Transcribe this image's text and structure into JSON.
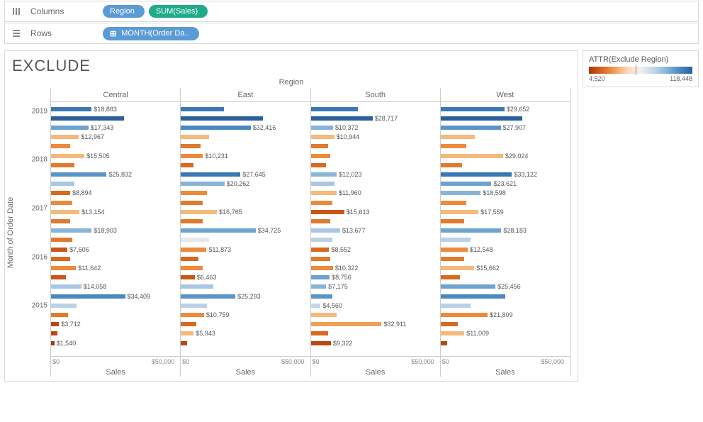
{
  "shelves": {
    "columns_label": "Columns",
    "rows_label": "Rows",
    "columns_pills": [
      {
        "label": "Region",
        "class": "blue"
      },
      {
        "label": "SUM(Sales)",
        "class": "green"
      }
    ],
    "rows_pills": [
      {
        "label": "MONTH(Order Da..",
        "class": "blue",
        "expand": true
      }
    ]
  },
  "title": "EXCLUDE",
  "region_header": "Region",
  "y_axis_title": "Month of Order Date",
  "x_axis_label": "Sales",
  "x_ticks": {
    "min": "$0",
    "max": "$50,000"
  },
  "y_year_ticks": [
    "2019",
    "2018",
    "2017",
    "2016",
    "2015"
  ],
  "legend": {
    "title": "ATTR(Exclude Region)",
    "min": "4,520",
    "max": "118,448",
    "marker_pct": 45
  },
  "chart_data": {
    "type": "bar",
    "title": "EXCLUDE",
    "xlabel": "Sales",
    "ylabel": "Month of Order Date",
    "xlim": [
      0,
      60000
    ],
    "color_field": "ATTR(Exclude Region)",
    "color_range": [
      4520,
      118448
    ],
    "panels": [
      "Central",
      "East",
      "South",
      "West"
    ],
    "labeled_values": {
      "Central": {
        "$18,883": 18883,
        "$17,343": 17343,
        "$12,967": 12967,
        "$15,505": 15505,
        "$25,832": 25832,
        "$8,894": 8894,
        "$13,154": 13154,
        "$18,903": 18903,
        "$7,606": 7606,
        "$11,642": 11642,
        "$14,058": 14058,
        "$34,409": 34409,
        "$3,712": 3712,
        "$1,540": 1540
      },
      "East": {
        "$32,416": 32416,
        "$10,231": 10231,
        "$27,645": 27645,
        "$20,262": 20262,
        "$16,765": 16765,
        "$34,725": 34725,
        "$11,873": 11873,
        "$6,463": 6463,
        "$25,293": 25293,
        "$10,759": 10759,
        "$5,943": 5943
      },
      "South": {
        "$28,717": 28717,
        "$10,372": 10372,
        "$10,944": 10944,
        "$12,023": 12023,
        "$11,960": 11960,
        "$15,613": 15613,
        "$13,677": 13677,
        "$8,552": 8552,
        "$10,322": 10322,
        "$8,756": 8756,
        "$7,175": 7175,
        "$4,560": 4560,
        "$32,911": 32911,
        "$9,322": 9322
      },
      "West": {
        "$29,652": 29652,
        "$27,907": 27907,
        "$29,024": 29024,
        "$33,122": 33122,
        "$23,621": 23621,
        "$18,598": 18598,
        "$17,559": 17559,
        "$28,183": 28183,
        "$12,548": 12548,
        "$15,662": 15662,
        "$25,456": 25456,
        "$21,809": 21809,
        "$11,009": 11009
      }
    }
  },
  "render_bars": {
    "Central": [
      {
        "t": 1,
        "v": 18883,
        "c": "#3a77b5",
        "l": "$18,883"
      },
      {
        "t": 2,
        "v": 34000,
        "c": "#2b5f9c"
      },
      {
        "t": 3,
        "v": 17343,
        "c": "#6fa3cf",
        "l": "$17,343"
      },
      {
        "t": 4,
        "v": 12967,
        "c": "#f4b97c",
        "l": "$12,967"
      },
      {
        "t": 5,
        "v": 9000,
        "c": "#ec8a3d"
      },
      {
        "t": 6,
        "v": 15505,
        "c": "#f4b97c",
        "l": "$15,505"
      },
      {
        "t": 7,
        "v": 11000,
        "c": "#e07a2e"
      },
      {
        "t": 8,
        "v": 25832,
        "c": "#5b94c8",
        "l": "$25,832"
      },
      {
        "t": 9,
        "v": 11000,
        "c": "#a9c7e2"
      },
      {
        "t": 10,
        "v": 8894,
        "c": "#d66a21",
        "l": "$8,894"
      },
      {
        "t": 11,
        "v": 10000,
        "c": "#ec8a3d"
      },
      {
        "t": 12,
        "v": 13154,
        "c": "#f4b97c",
        "l": "$13,154"
      },
      {
        "t": 13,
        "v": 9000,
        "c": "#e07a2e"
      },
      {
        "t": 14,
        "v": 18903,
        "c": "#88b4d8",
        "l": "$18,903"
      },
      {
        "t": 15,
        "v": 10000,
        "c": "#e07a2e"
      },
      {
        "t": 16,
        "v": 7606,
        "c": "#c95616",
        "l": "$7,606"
      },
      {
        "t": 17,
        "v": 9000,
        "c": "#d66a21"
      },
      {
        "t": 18,
        "v": 11642,
        "c": "#ec8a3d",
        "l": "$11,642"
      },
      {
        "t": 19,
        "v": 7000,
        "c": "#c95616"
      },
      {
        "t": 20,
        "v": 14058,
        "c": "#a9c7e2",
        "l": "$14,058"
      },
      {
        "t": 21,
        "v": 34409,
        "c": "#4a88c2",
        "l": "$34,409"
      },
      {
        "t": 22,
        "v": 12000,
        "c": "#b9d0e6"
      },
      {
        "t": 23,
        "v": 8000,
        "c": "#e07a2e"
      },
      {
        "t": 24,
        "v": 3712,
        "c": "#b84810",
        "l": "$3,712"
      },
      {
        "t": 25,
        "v": 3000,
        "c": "#b84810"
      },
      {
        "t": 26,
        "v": 1540,
        "c": "#a8360f",
        "l": "$1,540"
      }
    ],
    "East": [
      {
        "t": 1,
        "v": 20000,
        "c": "#3a77b5"
      },
      {
        "t": 2,
        "v": 38000,
        "c": "#2b5f9c"
      },
      {
        "t": 3,
        "v": 32416,
        "c": "#4a88c2",
        "l": "$32,416"
      },
      {
        "t": 4,
        "v": 13000,
        "c": "#f4b97c"
      },
      {
        "t": 5,
        "v": 9000,
        "c": "#e07a2e"
      },
      {
        "t": 6,
        "v": 10231,
        "c": "#ec8a3d",
        "l": "$10,231"
      },
      {
        "t": 7,
        "v": 6000,
        "c": "#d66a21"
      },
      {
        "t": 8,
        "v": 27645,
        "c": "#3a77b5",
        "l": "$27,645"
      },
      {
        "t": 9,
        "v": 20262,
        "c": "#88b4d8",
        "l": "$20,262"
      },
      {
        "t": 10,
        "v": 12000,
        "c": "#ec8a3d"
      },
      {
        "t": 11,
        "v": 10000,
        "c": "#e07a2e"
      },
      {
        "t": 12,
        "v": 16765,
        "c": "#f4b97c",
        "l": "$16,765"
      },
      {
        "t": 13,
        "v": 10000,
        "c": "#e07a2e"
      },
      {
        "t": 14,
        "v": 34725,
        "c": "#6fa3cf",
        "l": "$34,725"
      },
      {
        "t": 15,
        "v": 13000,
        "c": "#e5e9ec"
      },
      {
        "t": 16,
        "v": 11873,
        "c": "#ec8a3d",
        "l": "$11,873"
      },
      {
        "t": 17,
        "v": 8000,
        "c": "#d66a21"
      },
      {
        "t": 18,
        "v": 10000,
        "c": "#ec8a3d"
      },
      {
        "t": 19,
        "v": 6463,
        "c": "#c95616",
        "l": "$6,463"
      },
      {
        "t": 20,
        "v": 15000,
        "c": "#a9c7e2"
      },
      {
        "t": 21,
        "v": 25293,
        "c": "#5b94c8",
        "l": "$25,293"
      },
      {
        "t": 22,
        "v": 12000,
        "c": "#b9d0e6"
      },
      {
        "t": 23,
        "v": 10759,
        "c": "#ec8a3d",
        "l": "$10,759"
      },
      {
        "t": 24,
        "v": 7000,
        "c": "#d66a21"
      },
      {
        "t": 25,
        "v": 5943,
        "c": "#f4b97c",
        "l": "$5,943"
      },
      {
        "t": 26,
        "v": 3000,
        "c": "#b84810"
      }
    ],
    "South": [
      {
        "t": 1,
        "v": 22000,
        "c": "#3a77b5"
      },
      {
        "t": 2,
        "v": 28717,
        "c": "#2b5f9c",
        "l": "$28,717"
      },
      {
        "t": 3,
        "v": 10372,
        "c": "#88b4d8",
        "l": "$10,372"
      },
      {
        "t": 4,
        "v": 10944,
        "c": "#f4b97c",
        "l": "$10,944"
      },
      {
        "t": 5,
        "v": 8000,
        "c": "#e07a2e"
      },
      {
        "t": 6,
        "v": 9000,
        "c": "#ec8a3d"
      },
      {
        "t": 7,
        "v": 7000,
        "c": "#d66a21"
      },
      {
        "t": 8,
        "v": 12023,
        "c": "#88b4d8",
        "l": "$12,023"
      },
      {
        "t": 9,
        "v": 11000,
        "c": "#a9c7e2"
      },
      {
        "t": 10,
        "v": 11960,
        "c": "#f4b97c",
        "l": "$11,960"
      },
      {
        "t": 11,
        "v": 10000,
        "c": "#ec8a3d"
      },
      {
        "t": 12,
        "v": 15613,
        "c": "#c95616",
        "l": "$15,613"
      },
      {
        "t": 13,
        "v": 9000,
        "c": "#e07a2e"
      },
      {
        "t": 14,
        "v": 13677,
        "c": "#a9c7e2",
        "l": "$13,677"
      },
      {
        "t": 15,
        "v": 10000,
        "c": "#b9d0e6"
      },
      {
        "t": 16,
        "v": 8552,
        "c": "#d66a21",
        "l": "$8,552"
      },
      {
        "t": 17,
        "v": 9000,
        "c": "#e07a2e"
      },
      {
        "t": 18,
        "v": 10322,
        "c": "#ec8a3d",
        "l": "$10,322"
      },
      {
        "t": 19,
        "v": 8756,
        "c": "#6fa3cf",
        "l": "$8,756"
      },
      {
        "t": 20,
        "v": 7175,
        "c": "#88b4d8",
        "l": "$7,175"
      },
      {
        "t": 21,
        "v": 10000,
        "c": "#5b94c8"
      },
      {
        "t": 22,
        "v": 4560,
        "c": "#c2d6e8",
        "l": "$4,560"
      },
      {
        "t": 23,
        "v": 12000,
        "c": "#f4b97c"
      },
      {
        "t": 24,
        "v": 32911,
        "c": "#f0a056",
        "l": "$32,911"
      },
      {
        "t": 25,
        "v": 8000,
        "c": "#d66a21"
      },
      {
        "t": 26,
        "v": 9322,
        "c": "#b84810",
        "l": "$9,322"
      }
    ],
    "West": [
      {
        "t": 1,
        "v": 29652,
        "c": "#3a77b5",
        "l": "$29,652"
      },
      {
        "t": 2,
        "v": 38000,
        "c": "#2b5f9c"
      },
      {
        "t": 3,
        "v": 27907,
        "c": "#5b94c8",
        "l": "$27,907"
      },
      {
        "t": 4,
        "v": 16000,
        "c": "#f4b97c"
      },
      {
        "t": 5,
        "v": 12000,
        "c": "#ec8a3d"
      },
      {
        "t": 6,
        "v": 29024,
        "c": "#f4b97c",
        "l": "$29,024"
      },
      {
        "t": 7,
        "v": 10000,
        "c": "#e07a2e"
      },
      {
        "t": 8,
        "v": 33122,
        "c": "#3a77b5",
        "l": "$33,122"
      },
      {
        "t": 9,
        "v": 23621,
        "c": "#6fa3cf",
        "l": "$23,621"
      },
      {
        "t": 10,
        "v": 18598,
        "c": "#88b4d8",
        "l": "$18,598"
      },
      {
        "t": 11,
        "v": 12000,
        "c": "#ec8a3d"
      },
      {
        "t": 12,
        "v": 17559,
        "c": "#f4b97c",
        "l": "$17,559"
      },
      {
        "t": 13,
        "v": 11000,
        "c": "#e07a2e"
      },
      {
        "t": 14,
        "v": 28183,
        "c": "#6fa3cf",
        "l": "$28,183"
      },
      {
        "t": 15,
        "v": 14000,
        "c": "#b9d0e6"
      },
      {
        "t": 16,
        "v": 12548,
        "c": "#ec8a3d",
        "l": "$12,548"
      },
      {
        "t": 17,
        "v": 11000,
        "c": "#e07a2e"
      },
      {
        "t": 18,
        "v": 15662,
        "c": "#f4b97c",
        "l": "$15,662"
      },
      {
        "t": 19,
        "v": 9000,
        "c": "#d66a21"
      },
      {
        "t": 20,
        "v": 25456,
        "c": "#6fa3cf",
        "l": "$25,456"
      },
      {
        "t": 21,
        "v": 30000,
        "c": "#4a88c2"
      },
      {
        "t": 22,
        "v": 14000,
        "c": "#b9d0e6"
      },
      {
        "t": 23,
        "v": 21809,
        "c": "#ec8a3d",
        "l": "$21,809"
      },
      {
        "t": 24,
        "v": 8000,
        "c": "#d66a21"
      },
      {
        "t": 25,
        "v": 11009,
        "c": "#f4b97c",
        "l": "$11,009"
      },
      {
        "t": 26,
        "v": 3000,
        "c": "#b84810"
      }
    ]
  }
}
